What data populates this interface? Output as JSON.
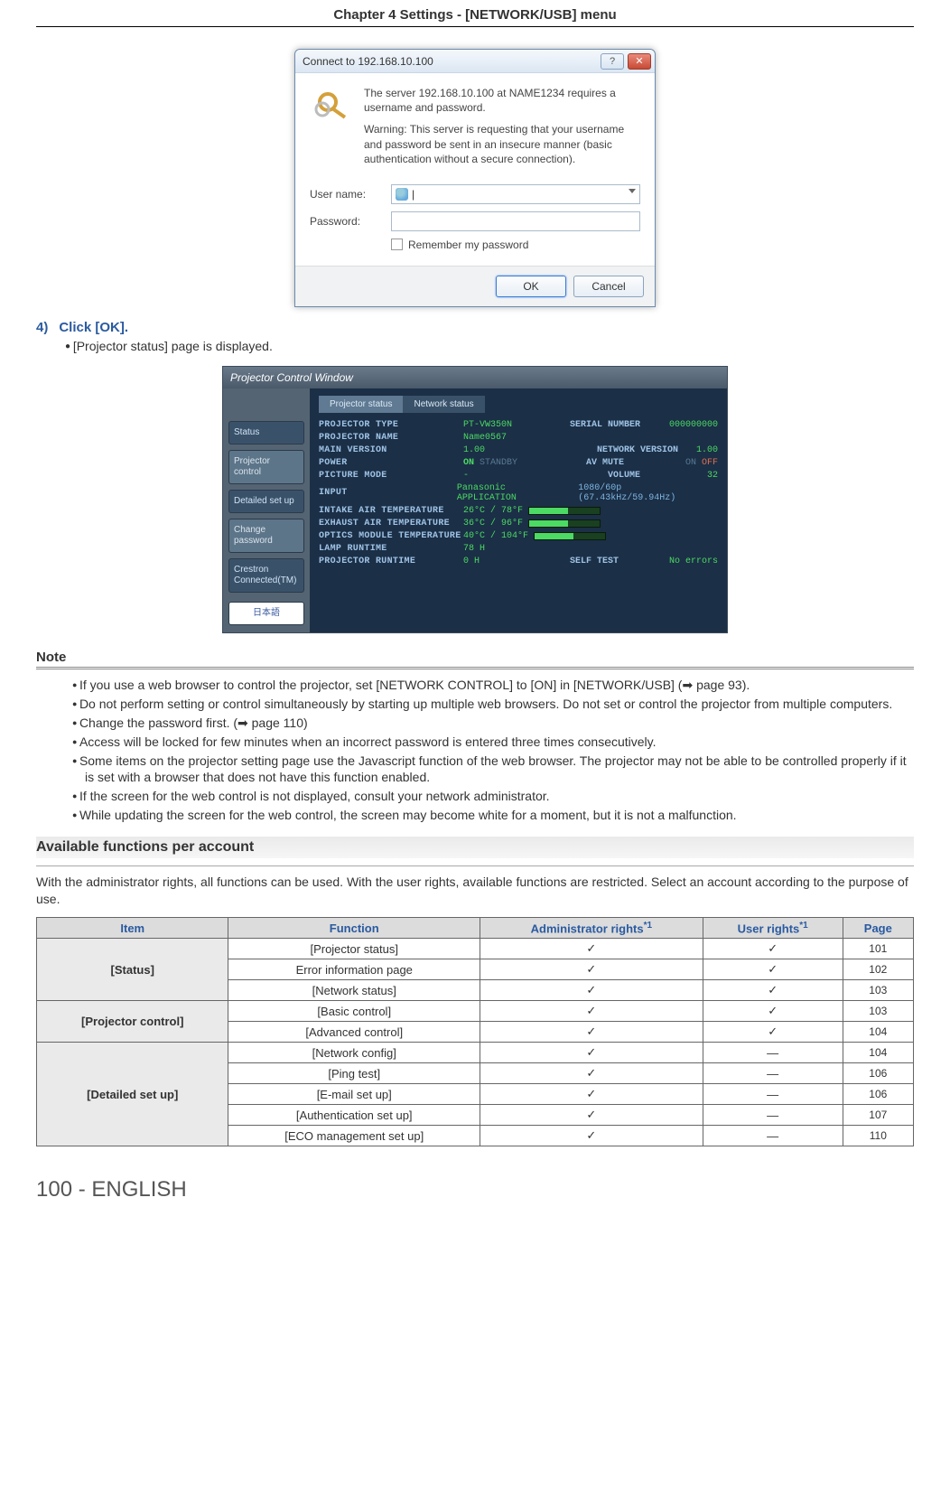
{
  "chapter_header": "Chapter 4   Settings - [NETWORK/USB] menu",
  "dialog": {
    "title": "Connect to 192.168.10.100",
    "msg1": "The server 192.168.10.100 at NAME1234 requires a username and password.",
    "msg2": "Warning: This server is requesting that your username and password be sent in an insecure manner (basic authentication without a secure connection).",
    "username_label": "User name:",
    "password_label": "Password:",
    "remember_label": "Remember my password",
    "ok": "OK",
    "cancel": "Cancel"
  },
  "step": {
    "num": "4)",
    "text": "Click [OK].",
    "sub": "[Projector status] page is displayed."
  },
  "pcw": {
    "title": "Projector Control Window",
    "sidetabs": [
      "Status",
      "Projector control",
      "Detailed set up",
      "Change password",
      "Crestron Connected(TM)"
    ],
    "jp_tab": "日本語",
    "toptabs": [
      "Projector status",
      "Network status"
    ],
    "rows": [
      {
        "l": "PROJECTOR TYPE",
        "v": "PT-VW350N",
        "l2": "SERIAL NUMBER",
        "v2": "000000000"
      },
      {
        "l": "PROJECTOR NAME",
        "v": "Name0567"
      },
      {
        "l": "MAIN VERSION",
        "v": "1.00",
        "l2": "NETWORK VERSION",
        "v2": "1.00"
      },
      {
        "l": "POWER",
        "v": "ON",
        "v_off": "STANDBY",
        "l2": "AV MUTE",
        "v2": "ON",
        "v2_off": "OFF"
      },
      {
        "l": "PICTURE MODE",
        "v": "-",
        "l2": "VOLUME",
        "v2": "32"
      },
      {
        "l": "INPUT",
        "v": "Panasonic APPLICATION",
        "v2": "1080/60p (67.43kHz/59.94Hz)"
      },
      {
        "l": "INTAKE AIR TEMPERATURE",
        "v": "26°C / 78°F",
        "bar": true
      },
      {
        "l": "EXHAUST AIR TEMPERATURE",
        "v": "36°C / 96°F",
        "bar": true
      },
      {
        "l": "OPTICS MODULE TEMPERATURE",
        "v": "40°C / 104°F",
        "bar": true
      },
      {
        "l": "LAMP RUNTIME",
        "v": "78 H"
      },
      {
        "l": "PROJECTOR RUNTIME",
        "v": "0 H",
        "l2": "SELF TEST",
        "v2": "No errors"
      }
    ]
  },
  "note_header": "Note",
  "notes": [
    "If you use a web browser to control the projector, set [NETWORK CONTROL] to [ON] in [NETWORK/USB] (➡ page 93).",
    "Do not perform setting or control simultaneously by starting up multiple web browsers. Do not set or control the projector from multiple computers.",
    "Change the password first. (➡ page 110)",
    "Access will be locked for few minutes when an incorrect password is entered three times consecutively.",
    "Some items on the projector setting page use the Javascript function of the web browser. The projector may not be able to be controlled properly if it is set with a browser that does not have this function enabled.",
    "If the screen for the web control is not displayed, consult your network administrator.",
    "While updating the screen for the web control, the screen may become white for a moment, but it is not a malfunction."
  ],
  "avail_header": "Available functions per account",
  "avail_intro": "With the administrator rights, all functions can be used. With the user rights, available functions are restricted. Select an account according to the purpose of use.",
  "table": {
    "headers": [
      "Item",
      "Function",
      "Administrator rights",
      "User rights",
      "Page"
    ],
    "sup": "*1",
    "groups": [
      {
        "item": "[Status]",
        "rows": [
          {
            "fn": "[Projector status]",
            "admin": "✓",
            "user": "✓",
            "page": "101"
          },
          {
            "fn": "Error information page",
            "admin": "✓",
            "user": "✓",
            "page": "102"
          },
          {
            "fn": "[Network status]",
            "admin": "✓",
            "user": "✓",
            "page": "103"
          }
        ]
      },
      {
        "item": "[Projector control]",
        "rows": [
          {
            "fn": "[Basic control]",
            "admin": "✓",
            "user": "✓",
            "page": "103"
          },
          {
            "fn": "[Advanced control]",
            "admin": "✓",
            "user": "✓",
            "page": "104"
          }
        ]
      },
      {
        "item": "[Detailed set up]",
        "rows": [
          {
            "fn": "[Network config]",
            "admin": "✓",
            "user": "―",
            "page": "104"
          },
          {
            "fn": "[Ping test]",
            "admin": "✓",
            "user": "―",
            "page": "106"
          },
          {
            "fn": "[E-mail set up]",
            "admin": "✓",
            "user": "―",
            "page": "106"
          },
          {
            "fn": "[Authentication set up]",
            "admin": "✓",
            "user": "―",
            "page": "107"
          },
          {
            "fn": "[ECO management set up]",
            "admin": "✓",
            "user": "―",
            "page": "110"
          }
        ]
      }
    ]
  },
  "page_number": "100 - ENGLISH"
}
